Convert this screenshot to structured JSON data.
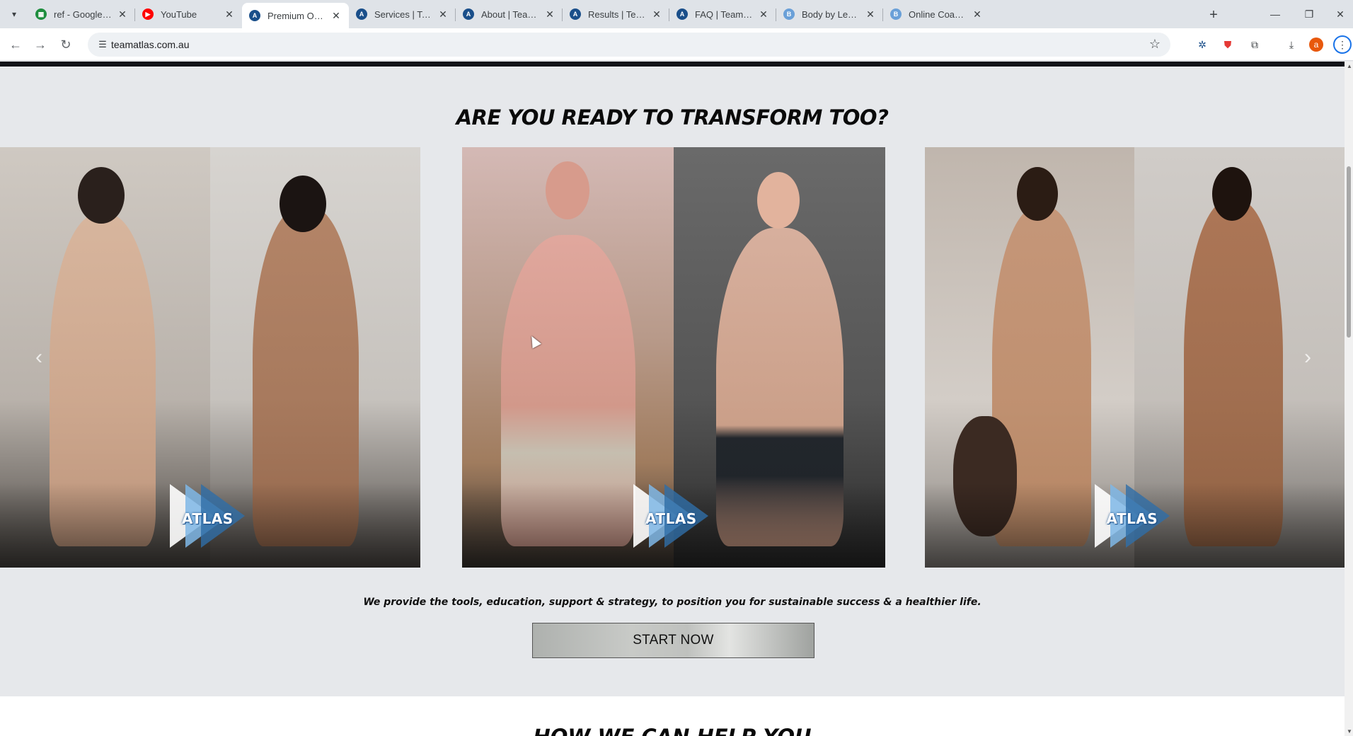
{
  "browser": {
    "tabs": [
      {
        "title": "ref - Google Sheets",
        "icon": "google-sheets-icon",
        "color": "#1e8e3e",
        "glyph": "▦",
        "active": false
      },
      {
        "title": "YouTube",
        "icon": "youtube-icon",
        "color": "#ff0000",
        "glyph": "▶",
        "active": false
      },
      {
        "title": "Premium Online Physique",
        "icon": "team-atlas-icon",
        "color": "#1a4f8a",
        "glyph": "A",
        "active": true
      },
      {
        "title": "Services | Team Atlas",
        "icon": "team-atlas-icon",
        "color": "#1a4f8a",
        "glyph": "A",
        "active": false
      },
      {
        "title": "About | Team Atlas",
        "icon": "team-atlas-icon",
        "color": "#1a4f8a",
        "glyph": "A",
        "active": false
      },
      {
        "title": "Results | Team Atlas",
        "icon": "team-atlas-icon",
        "color": "#1a4f8a",
        "glyph": "A",
        "active": false
      },
      {
        "title": "FAQ | Team Atlas",
        "icon": "team-atlas-icon",
        "color": "#1a4f8a",
        "glyph": "A",
        "active": false
      },
      {
        "title": "Body by Leon | Personal",
        "icon": "body-by-leon-icon",
        "color": "#6aa0d8",
        "glyph": "B",
        "active": false
      },
      {
        "title": "Online Coaching - Body",
        "icon": "body-by-leon-icon",
        "color": "#6aa0d8",
        "glyph": "B",
        "active": false
      }
    ],
    "url": "teamatlas.com.au",
    "profile_initial": "a"
  },
  "page": {
    "headline": "ARE YOU READY TO TRANSFORM TOO?",
    "cards": [
      {
        "name": "transformation-card-woman-1",
        "logo_text": "ATLAS"
      },
      {
        "name": "transformation-card-man",
        "logo_text": "ATLAS"
      },
      {
        "name": "transformation-card-woman-2",
        "logo_text": "ATLAS"
      }
    ],
    "tagline": "We provide the tools, education, support & strategy, to position you for sustainable success & a healthier life.",
    "cta_label": "START NOW",
    "next_section_heading": "HOW WE CAN HELP YOU"
  },
  "colors": {
    "page_background": "#e6e8eb",
    "accent_blue": "#1a4f8a"
  }
}
